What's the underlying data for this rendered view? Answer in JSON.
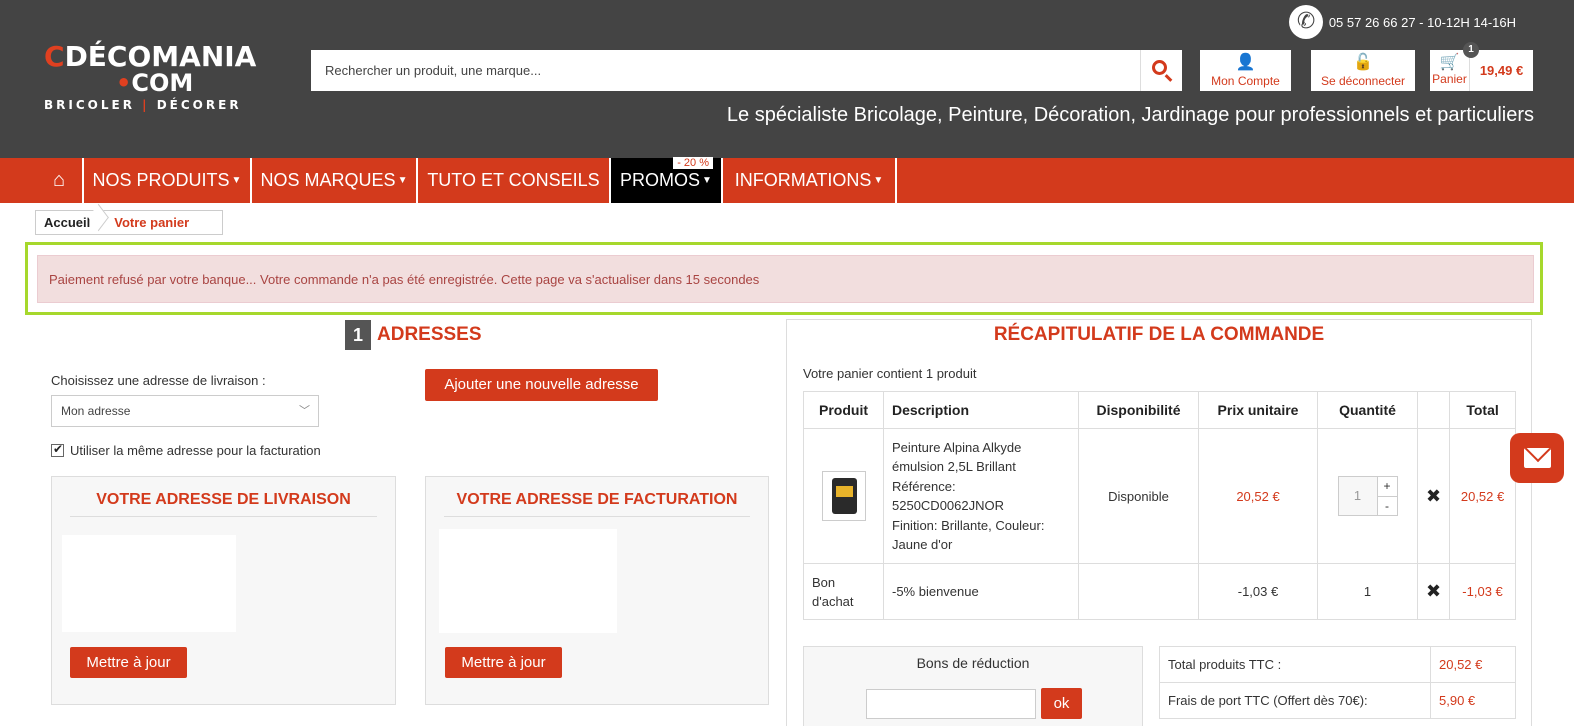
{
  "header": {
    "phone": "05 57 26 66 27 - 10-12H 14-16H",
    "logo": {
      "line1": "DÉCOMANIA",
      "line1_c": "C",
      "line2": "COM",
      "line3a": "BRICOLER",
      "line3b": "DÉCORER"
    },
    "search_placeholder": "Rechercher un produit, une marque...",
    "account_label": "Mon Compte",
    "logout_label": "Se déconnecter",
    "cart_label": "Panier",
    "cart_count": "1",
    "cart_total": "19,49 €",
    "tagline": "Le spécialiste Bricolage, Peinture, Décoration, Jardinage pour professionnels et particuliers"
  },
  "nav": {
    "items": [
      "NOS PRODUITS",
      "NOS MARQUES",
      "TUTO ET CONSEILS",
      "PROMOS",
      "INFORMATIONS"
    ],
    "promo_badge": "- 20 %"
  },
  "breadcrumb": [
    "Accueil",
    "Votre panier"
  ],
  "alert": "Paiement refusé par votre banque... Votre commande n'a pas été enregistrée. Cette page va s'actualiser dans 15 secondes",
  "addresses": {
    "step_num": "1",
    "step_label": "ADRESSES",
    "choose_label": "Choisissez une adresse de livraison :",
    "selected": "Mon adresse",
    "add_button": "Ajouter une nouvelle adresse",
    "same_billing": "Utiliser la même adresse pour la facturation",
    "delivery_title": "VOTRE ADRESSE DE LIVRAISON",
    "billing_title": "VOTRE ADRESSE DE FACTURATION",
    "update_button": "Mettre à jour"
  },
  "summary": {
    "title": "RÉCAPITULATIF DE LA COMMANDE",
    "contains": "Votre panier contient 1 produit",
    "columns": [
      "Produit",
      "Description",
      "Disponibilité",
      "Prix unitaire",
      "Quantité",
      "",
      "Total"
    ],
    "product": {
      "desc1": "Peinture Alpina Alkyde émulsion 2,5L Brillant",
      "desc2": "Référence: 5250CD0062JNOR",
      "desc3": "Finition: Brillante, Couleur: Jaune d'or",
      "availability": "Disponible",
      "unit_price": "20,52 €",
      "qty": "1",
      "total": "20,52 €"
    },
    "voucher_row": {
      "label": "Bon d'achat",
      "desc": "-5% bienvenue",
      "unit_price": "-1,03 €",
      "qty": "1",
      "total": "-1,03 €"
    },
    "vouchers_title": "Bons de réduction",
    "ok": "ok",
    "totals": [
      {
        "label": "Total produits TTC :",
        "value": "20,52 €"
      },
      {
        "label": "Frais de port TTC (Offert dès 70€):",
        "value": "5,90 €"
      }
    ]
  },
  "colors": {
    "accent": "#d33a1c",
    "header_bg": "#444444",
    "alert_bg": "#f2dede",
    "highlight": "#a6d82c"
  }
}
